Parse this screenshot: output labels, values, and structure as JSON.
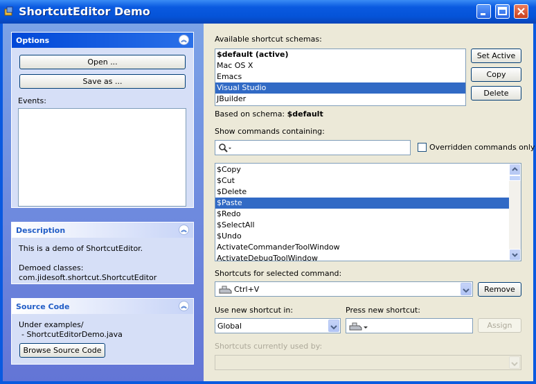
{
  "window": {
    "title": "ShortcutEditor Demo"
  },
  "left": {
    "options": {
      "title": "Options",
      "open_label": "Open ...",
      "saveas_label": "Save as ...",
      "events_label": "Events:"
    },
    "description": {
      "title": "Description",
      "line1": "This is a demo of ShortcutEditor.",
      "line2": "Demoed classes:",
      "line3": "com.jidesoft.shortcut.ShortcutEditor"
    },
    "source": {
      "title": "Source Code",
      "line1": "Under examples/",
      "line2": "- ShortcutEditorDemo.java",
      "browse_label": "Browse Source Code"
    }
  },
  "schemas": {
    "label": "Available shortcut schemas:",
    "items": [
      "$default (active)",
      "Mac OS X",
      "Emacs",
      "Visual Studio",
      "JBuilder"
    ],
    "selected": 3,
    "set_active": "Set Active",
    "copy": "Copy",
    "delete": "Delete",
    "based_on_label": "Based on schema:",
    "based_on_value": "$default"
  },
  "commands": {
    "filter_label": "Show commands containing:",
    "filter_value": "",
    "overridden_label": "Overridden commands only",
    "items": [
      "$Copy",
      "$Cut",
      "$Delete",
      "$Paste",
      "$Redo",
      "$SelectAll",
      "$Undo",
      "ActivateCommanderToolWindow",
      "ActivateDebugToolWindow"
    ],
    "selected": 3
  },
  "shortcuts": {
    "label": "Shortcuts for selected command:",
    "value": "Ctrl+V",
    "remove": "Remove",
    "use_in_label": "Use new shortcut in:",
    "use_in_value": "Global",
    "press_label": "Press new shortcut:",
    "assign": "Assign",
    "used_by_label": "Shortcuts currently used by:"
  }
}
